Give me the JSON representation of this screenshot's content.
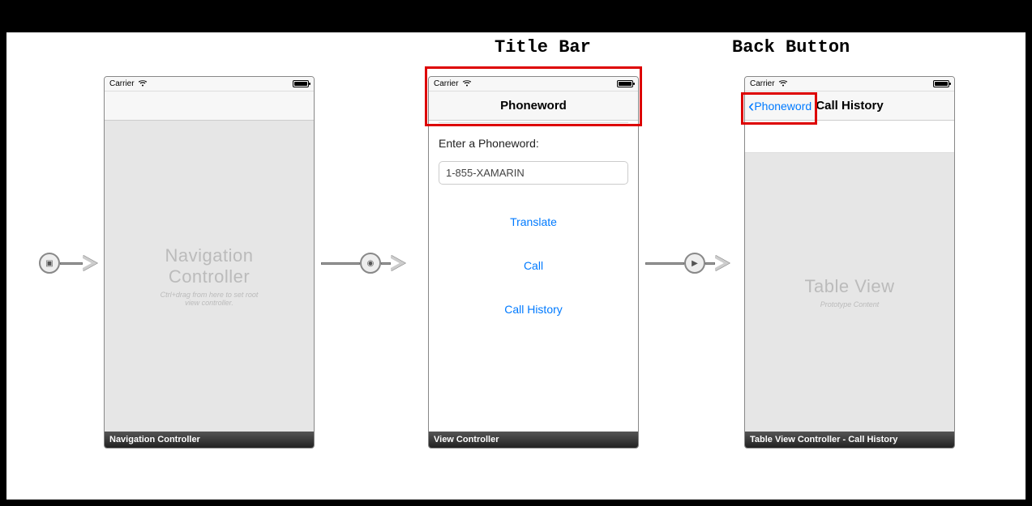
{
  "annotations": {
    "title_bar": "Title Bar",
    "back_button": "Back Button"
  },
  "screens": {
    "nav": {
      "status_carrier": "Carrier",
      "placeholder_title": "Navigation Controller",
      "placeholder_sub": "Ctrl+drag from here to set root view controller.",
      "footer": "Navigation Controller"
    },
    "view": {
      "status_carrier": "Carrier",
      "nav_title": "Phoneword",
      "label": "Enter a Phoneword:",
      "textfield_value": "1-855-XAMARIN",
      "btn_translate": "Translate",
      "btn_call": "Call",
      "btn_history": "Call History",
      "footer": "View Controller"
    },
    "table": {
      "status_carrier": "Carrier",
      "back_label": "Phoneword",
      "nav_title": "Call History",
      "placeholder_title": "Table View",
      "placeholder_sub": "Prototype Content",
      "footer": "Table View Controller - Call History"
    }
  }
}
